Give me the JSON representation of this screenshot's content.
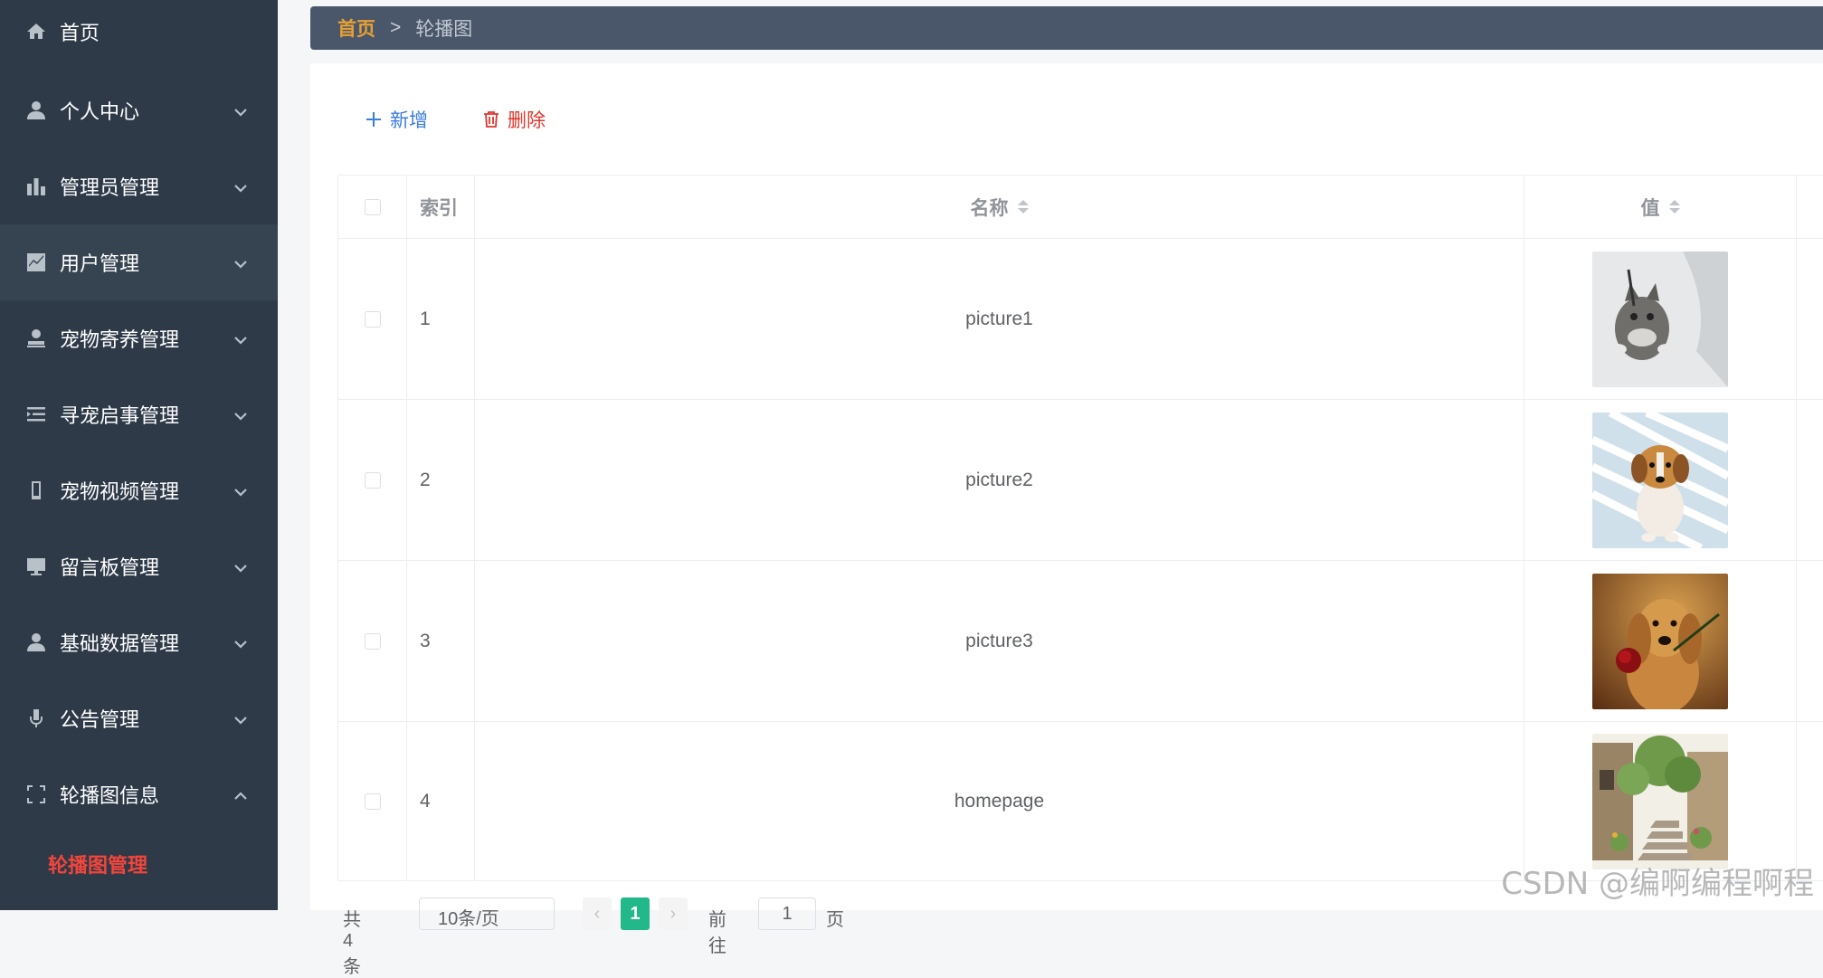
{
  "sidebar": {
    "items": [
      {
        "label": "首页",
        "icon": "home-icon",
        "has_submenu": false
      },
      {
        "label": "个人中心",
        "icon": "user-icon",
        "has_submenu": true
      },
      {
        "label": "管理员管理",
        "icon": "bar-chart-icon",
        "has_submenu": true
      },
      {
        "label": "用户管理",
        "icon": "line-chart-icon",
        "has_submenu": true
      },
      {
        "label": "宠物寄养管理",
        "icon": "stamp-icon",
        "has_submenu": true
      },
      {
        "label": "寻宠启事管理",
        "icon": "list-indent-icon",
        "has_submenu": true
      },
      {
        "label": "宠物视频管理",
        "icon": "phone-icon",
        "has_submenu": true
      },
      {
        "label": "留言板管理",
        "icon": "monitor-icon",
        "has_submenu": true
      },
      {
        "label": "基础数据管理",
        "icon": "user-icon",
        "has_submenu": true
      },
      {
        "label": "公告管理",
        "icon": "microphone-icon",
        "has_submenu": true
      },
      {
        "label": "轮播图信息",
        "icon": "fullscreen-icon",
        "has_submenu": true,
        "expanded": true
      }
    ],
    "active_sub_item": "轮播图管理"
  },
  "breadcrumb": {
    "home": "首页",
    "separator": ">",
    "current": "轮播图"
  },
  "toolbar": {
    "add_label": "新增",
    "delete_label": "删除"
  },
  "table": {
    "headers": {
      "index": "索引",
      "name": "名称",
      "value": "值"
    },
    "rows": [
      {
        "index": "1",
        "name": "picture1",
        "image": "cat-image"
      },
      {
        "index": "2",
        "name": "picture2",
        "image": "puppy-image"
      },
      {
        "index": "3",
        "name": "picture3",
        "image": "dog-rose-image"
      },
      {
        "index": "4",
        "name": "homepage",
        "image": "village-stairs-image"
      }
    ]
  },
  "pagination": {
    "total": "共 4 条",
    "page_size": "10条/页",
    "current_page": "1",
    "goto_label": "前往",
    "jump_value": "1",
    "page_word": "页"
  },
  "watermark": "CSDN @编啊编程啊程",
  "colors": {
    "sidebar_bg": "#2e3a48",
    "breadcrumb_bg": "#4a5669",
    "breadcrumb_home": "#e8a035",
    "active_sub_item": "#f2453b",
    "add_button": "#3a7be0",
    "delete_button": "#e0352b",
    "pager_active": "#23b88a"
  }
}
